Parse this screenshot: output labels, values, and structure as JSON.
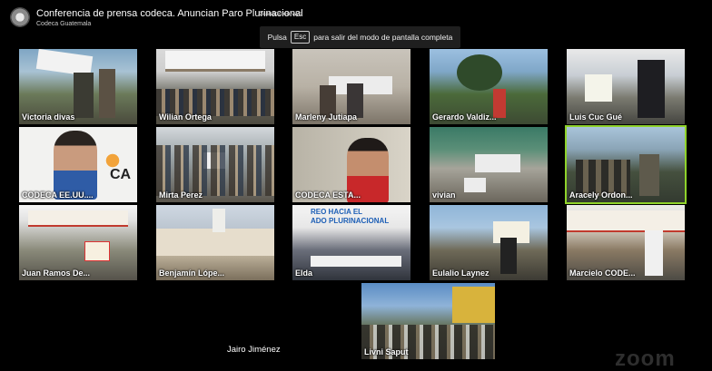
{
  "meeting": {
    "title": "Conferencia de prensa codeca. Anuncian Paro Plurinacional",
    "live_label": "Grabado en vivo",
    "host_org": "Codeca Guatemala",
    "host_avatar_icon": "people-avatar-icon"
  },
  "fullscreen_hint": {
    "prefix": "Pulsa",
    "key": "Esc",
    "suffix": "para salir del modo de pantalla completa"
  },
  "participants": [
    {
      "name": "Victoria divas"
    },
    {
      "name": "Wilian Ortega"
    },
    {
      "name": "Marleny Jutiapa"
    },
    {
      "name": "Gerardo Valdiz..."
    },
    {
      "name": "Luis Cuc Gué"
    },
    {
      "name": "CODECA EE.UU...."
    },
    {
      "name": "Mirta Perez"
    },
    {
      "name": "CODECA ESTA..."
    },
    {
      "name": "vivian"
    },
    {
      "name": "Aracely Ordon...",
      "active_speaker": true
    },
    {
      "name": "Juan Ramos De..."
    },
    {
      "name": "Benjamín Lópe..."
    },
    {
      "name": "Elda"
    },
    {
      "name": "Eulalio Laynez"
    },
    {
      "name": "Marcielo CODE..."
    },
    {
      "name": "Livni Saput"
    }
  ],
  "tile_artwork": {
    "codeca_logo_text": "CA",
    "elda_banner_line1": "REO HACIA EL",
    "elda_banner_line2": "ADO PLURINACIONAL"
  },
  "non_video_participant": {
    "name": "Jairo Jiménez"
  },
  "watermark": {
    "text": "zoom"
  },
  "colors": {
    "background": "#000000",
    "tile": "#2e2e2e",
    "active_speaker_border": "#8fd22a"
  }
}
